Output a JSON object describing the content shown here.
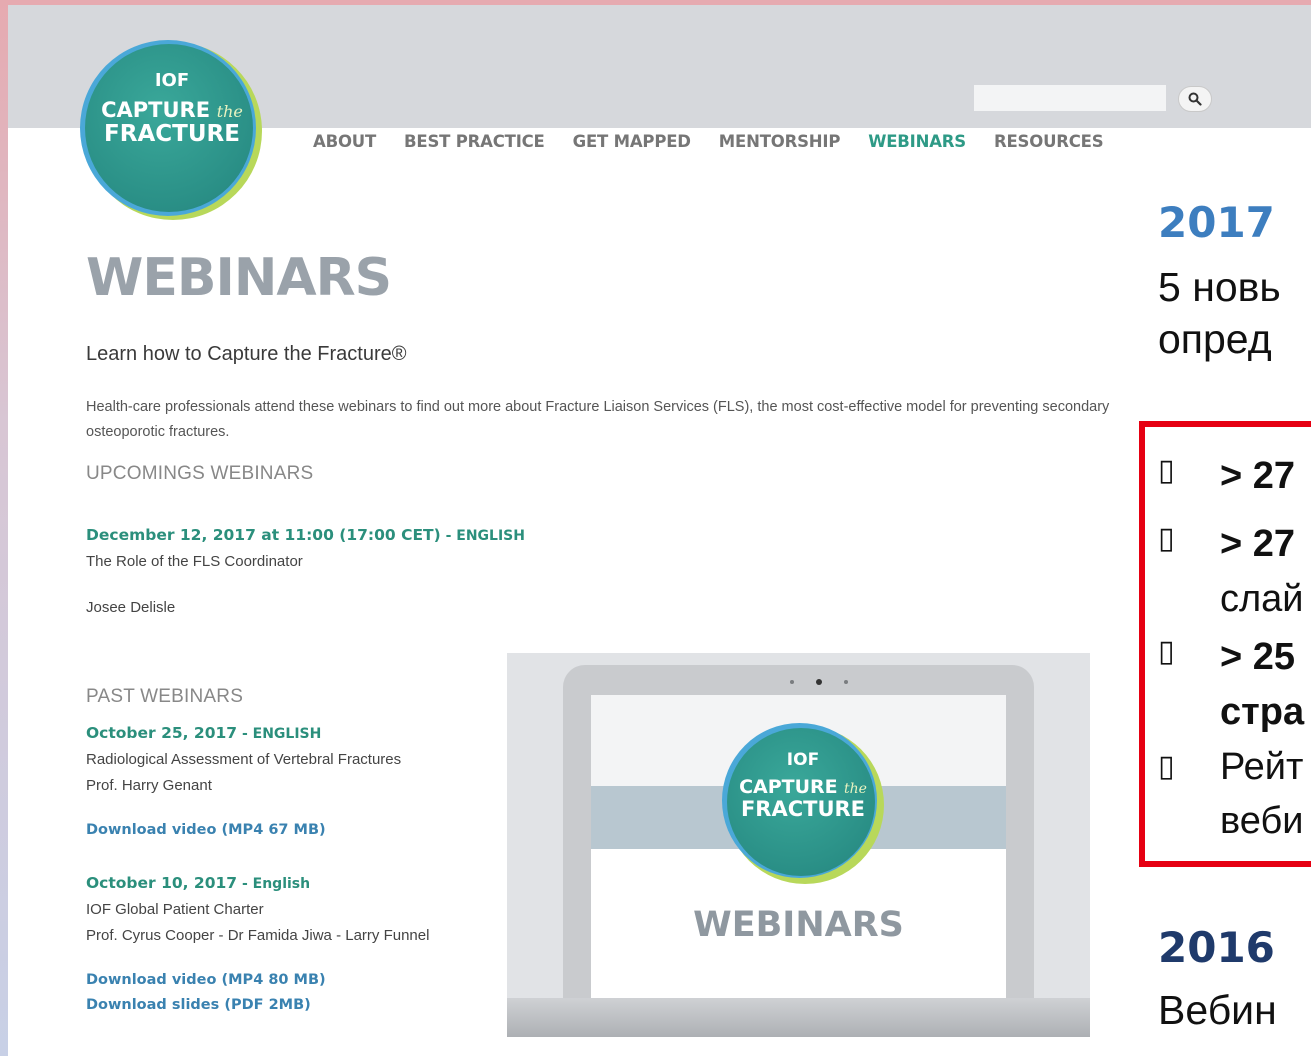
{
  "site": {
    "logo": {
      "org": "IOF",
      "line1": "CAPTURE",
      "the": "the",
      "line2": "FRACTURE"
    },
    "nav": [
      "ABOUT",
      "BEST PRACTICE",
      "GET MAPPED",
      "MENTORSHIP",
      "WEBINARS",
      "RESOURCES"
    ],
    "active_nav": "WEBINARS",
    "search": {
      "value": "",
      "icon": "search-icon"
    }
  },
  "page": {
    "title": "WEBINARS",
    "subtitle": "Learn how to Capture the Fracture®",
    "intro": "Health-care professionals attend these webinars to find out more about Fracture Liaison Services (FLS), the most cost-effective model for preventing secondary osteoporotic fractures.",
    "upcoming_heading": "UPCOMINGS WEBINARS",
    "upcoming": {
      "date": "December 12, 2017 at 11:00 (17:00 CET)",
      "lang": " - ENGLISH",
      "title": "The Role of the FLS Coordinator",
      "speaker": "Josee Delisle"
    },
    "past_heading": "PAST WEBINARS",
    "past": [
      {
        "date": "October 25, 2017",
        "lang": "  - ENGLISH",
        "title": "Radiological Assessment of Vertebral Fractures",
        "speaker": "Prof. Harry Genant",
        "links": [
          "Download video (MP4 67 MB)"
        ]
      },
      {
        "date": "October 10, 2017",
        "lang": "  - English",
        "title": "IOF Global Patient Charter",
        "speaker": "Prof. Cyrus Cooper - Dr Famida Jiwa - Larry Funnel",
        "links": [
          "Download video (MP4 80 MB)",
          "Download slides (PDF 2MB)"
        ]
      }
    ],
    "laptop_screen_title": "WEBINARS"
  },
  "slide": {
    "year_2017": "2017",
    "text_2017_line1": "5 новь",
    "text_2017_line2": "опред",
    "stats": [
      {
        "bullet": "▯",
        "text": "> 27"
      },
      {
        "bullet": "▯",
        "text": "> 27"
      },
      {
        "bullet": "",
        "text": "слай"
      },
      {
        "bullet": "▯",
        "text": "> 25"
      },
      {
        "bullet": "",
        "text": "стра"
      },
      {
        "bullet": "▯",
        "text": "Рейт"
      },
      {
        "bullet": "",
        "text": "веби"
      }
    ],
    "year_2016": "2016",
    "text_2016_line1": "Вебин",
    "colors": {
      "year_2017": "#3d7ebf",
      "year_2016": "#1f3a6b",
      "box_border": "#e60012",
      "accent": "#2e9a86"
    }
  }
}
